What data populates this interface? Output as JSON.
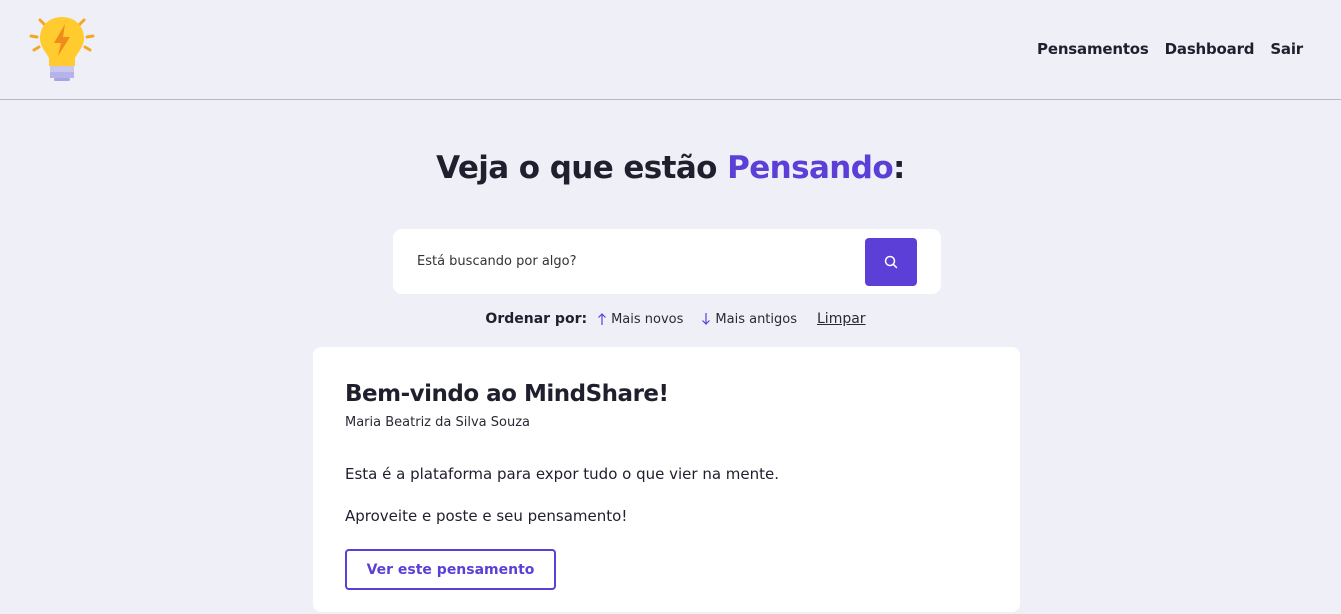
{
  "app": {
    "logo_icon": "lightbulb-lightning-icon"
  },
  "nav": {
    "items": [
      {
        "label": "Pensamentos"
      },
      {
        "label": "Dashboard"
      },
      {
        "label": "Sair"
      }
    ]
  },
  "hero": {
    "title_prefix": "Veja o que estão ",
    "title_accent": "Pensando",
    "title_suffix": ":"
  },
  "search": {
    "placeholder": "Está buscando por algo?",
    "value": "",
    "button_icon": "search-icon"
  },
  "order": {
    "label": "Ordenar por:",
    "newest": "Mais novos",
    "oldest": "Mais antigos",
    "clear": "Limpar"
  },
  "thought": {
    "title": "Bem-vindo ao MindShare!",
    "author": "Maria Beatriz da Silva Souza",
    "body_1": "Esta é a plataforma para expor tudo o que vier na mente.",
    "body_2": "Aproveite e poste e seu pensamento!",
    "button_label": "Ver este pensamento"
  },
  "colors": {
    "accent": "#5b3fd6",
    "background": "#efeff8",
    "card": "#ffffff"
  }
}
